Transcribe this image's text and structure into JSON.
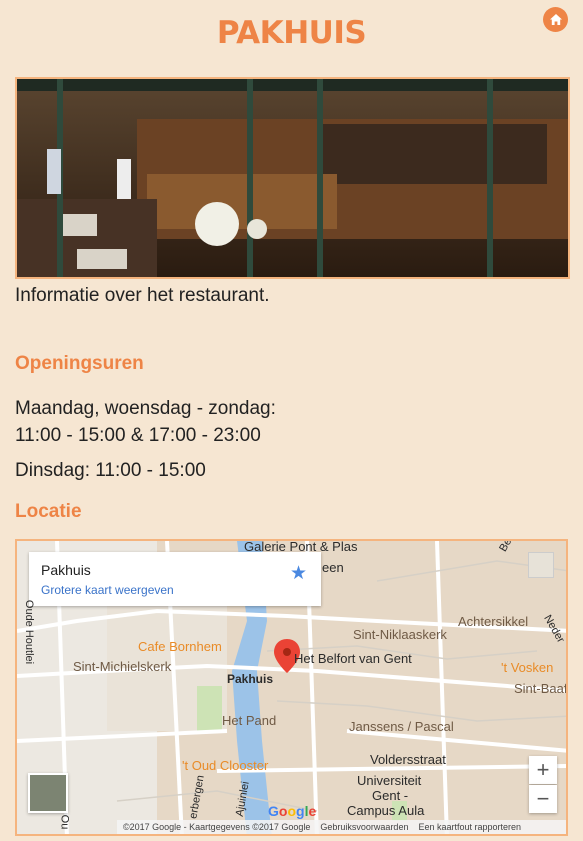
{
  "header": {
    "title": "PAKHUIS",
    "home_icon": "home-icon"
  },
  "intro_text": "Informatie over het restaurant.",
  "opening": {
    "heading": "Openingsuren",
    "line1a": "Maandag, woensdag - zondag:",
    "line1b": "11:00 - 15:00 & 17:00 - 23:00",
    "line2": "Dinsdag: 11:00 - 15:00"
  },
  "location": {
    "heading": "Locatie"
  },
  "map": {
    "card_name": "Pakhuis",
    "card_link": "Grotere kaart weergeven",
    "labels": {
      "galerie": "Galerie Pont & Plas",
      "cafe": "Cafe Bornhem",
      "michiel": "Sint-Michielskerk",
      "niklaas": "Sint-Niklaaskerk",
      "belfort": "Het Belfort van Gent",
      "achter": "Achtersikkel",
      "vosken": "'t Vosken",
      "baaf": "Sint-Baaf",
      "pakhuis": "Pakhuis",
      "pand": "Het Pand",
      "janssens": "Janssens / Pascal",
      "clooster": "'t Oud Clooster",
      "volders": "Voldersstraat",
      "univ1": "Universiteit",
      "univ2": "Gent -",
      "univ3": "Campus Aula",
      "oude": "Oude Houtlei",
      "zeen": "een",
      "google": "Google",
      "nerbergen": "erbergen",
      "ajuinlei": "Ajuinlei",
      "be": "Be",
      "ned": "Neder",
      "ou": "Ou"
    },
    "zoom_in": "+",
    "zoom_out": "−",
    "footer": [
      "©2017 Google - Kaartgegevens ©2017 Google",
      "Gebruiksvoorwaarden",
      "Een kaartfout rapporteren"
    ]
  }
}
